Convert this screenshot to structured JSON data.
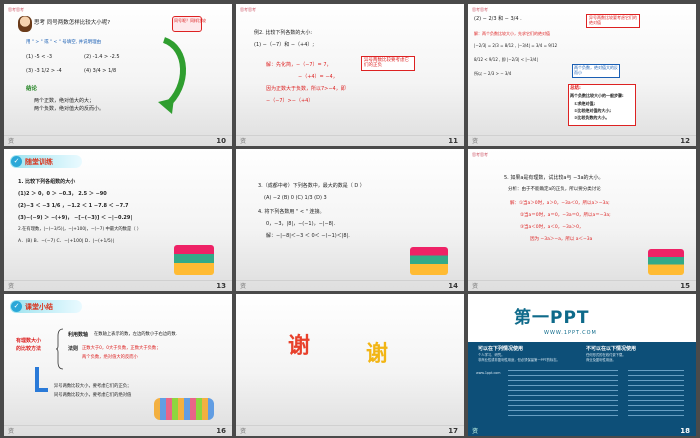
{
  "s1": {
    "tag": "思考思考",
    "title": "思考  同号两数怎样比较大小呢?",
    "note": "同号呢？同样比较",
    "instruction": "用 \" > \" 或 \" < \" 号填空, 并说明理由",
    "items": [
      "(1) -5 < -3",
      "(2) -1.4 > -2.5",
      "(3) -3 1/2 > -4",
      "(4) 3/4 > 1/8"
    ],
    "conclusion_label": "结论",
    "conclusion": [
      "两个正数，绝对值大的大；",
      "两个负数，绝对值大的反而小。"
    ],
    "page": "10",
    "footer": "资"
  },
  "s2": {
    "tag": "思考思考",
    "lines": [
      "例2. 比较下列各数的大小:",
      "(1) −（−7）和 −（+4）;"
    ],
    "solution": [
      "解：先化简，−（−7）= 7，",
      "−（+4）= −4，",
      "因为正数大于负数，所以7>−4，即",
      "−（−7）>−（+4）"
    ],
    "box": "异号两数比较要考虑它们的正负",
    "page": "11",
    "footer": "资"
  },
  "s3": {
    "tag": "思考思考",
    "head": "(2) − 2/3 和 − 3/4 .",
    "box1": "异号两数比较要考虑它们的绝对值",
    "solution": [
      "解：两个负数比较大小，先求它们的绝对值",
      "|−2/3| = 2/3 = 8/12 ,  |−3/4| = 3/4 = 9/12",
      "8/12 < 9/12 ,  即 |−2/3| < |−3/4|",
      "所以 − 2/3 > − 3/4"
    ],
    "box2": "两个负数，绝对值大的反而小",
    "summary_title": "总结:",
    "summary_head": "两个负数比较大小的一般步骤:",
    "summary_steps": [
      "①求绝对值;",
      "②比较绝对值的大小;",
      "③比较负数的大小。"
    ],
    "page": "12",
    "footer": "资"
  },
  "s4": {
    "header": "随堂训练",
    "line1": "1. 比较下列各组数的大小",
    "line2": "(1)2 ＞ 0，0 ＞ −0.3，   2.5 ＞ −90",
    "line3": "(2)−3 ＜ −3 1/6 ，−1.2 ＜ 1      −7.8 ＜ −7.7",
    "line4": "(3)−(−9) ＞ −(+9)，  −[−(−3)] ＜ −|−0.29|",
    "line5": "2.在有理数，|−(−3/5)|，−|+100|，−(−7) 中最大的数是（  ）",
    "options": "A．(B) B．−(−7)   C．−|+100|   D．|−(+1/5)|",
    "page": "13",
    "footer": "资"
  },
  "s5": {
    "line1": "3.（成都中考）下列各数中，最大的数是（ D ）",
    "opts": "(A) −2        (B) 0        (C) 1/3        (D) 3",
    "line2": "4. 将下列各数用 \" < \" 连接。",
    "line3": "0，−3，|8|，−(−1)，−|−8|.",
    "answer": "解：−|−8|＜−3 ＜ 0＜ −(−1)＜|8|.",
    "page": "14",
    "footer": "资"
  },
  "s6": {
    "tag": "思考思考",
    "line1": "5. 如果a是有理数，试比较a与 −3a的大小。",
    "line2": "分析：由于不能确定a的正负，所以要分类讨论",
    "sol1": "解：①当a＞0时，a＞0，−3a＜0，所以a＞−3a;",
    "sol2": "②当a＝0时，a＝0，−3a＝0，所以a＝−3a;",
    "sol3": "③当a＜0时，a＜0，−3a＞0，",
    "sol4": "因为 −3a＞−a，所以 a＜−3a",
    "page": "15",
    "footer": "资"
  },
  "s7": {
    "header": "课堂小结",
    "left": [
      "有理数大小",
      "的比较方法"
    ],
    "r1_label": "利用数轴",
    "r1_text": "在数轴上表示的数，左边的数小于右边的数.",
    "r2_label": "法则",
    "r2_lines": [
      "正数大于0，0大于负数，正数大于负数；",
      "两个负数，绝对值大的反而小"
    ],
    "bottom": [
      "异号两数比较大小，要考虑它们的正负；",
      "同号两数比较大小，要考虑它们的绝对值"
    ],
    "page": "16",
    "footer": "资"
  },
  "s8": {
    "char1": "谢",
    "char2": "谢",
    "page": "17",
    "footer": "资"
  },
  "s9": {
    "logo": "第一PPT",
    "url": "WWW.1PPT.COM",
    "sub": "www.1ppt.com",
    "col1_title": "可以在下列情况使用",
    "col1_lines": [
      "个人学习、研究。",
      "非商业性或非盈利性用途，但必须保留第一PPT的标志。"
    ],
    "col2_title": "不可以在以下情况使用",
    "col2_lines": [
      "任何形式的在线付费下载。",
      "商业及盈利性用途。"
    ],
    "page": "18",
    "footer": "资"
  }
}
